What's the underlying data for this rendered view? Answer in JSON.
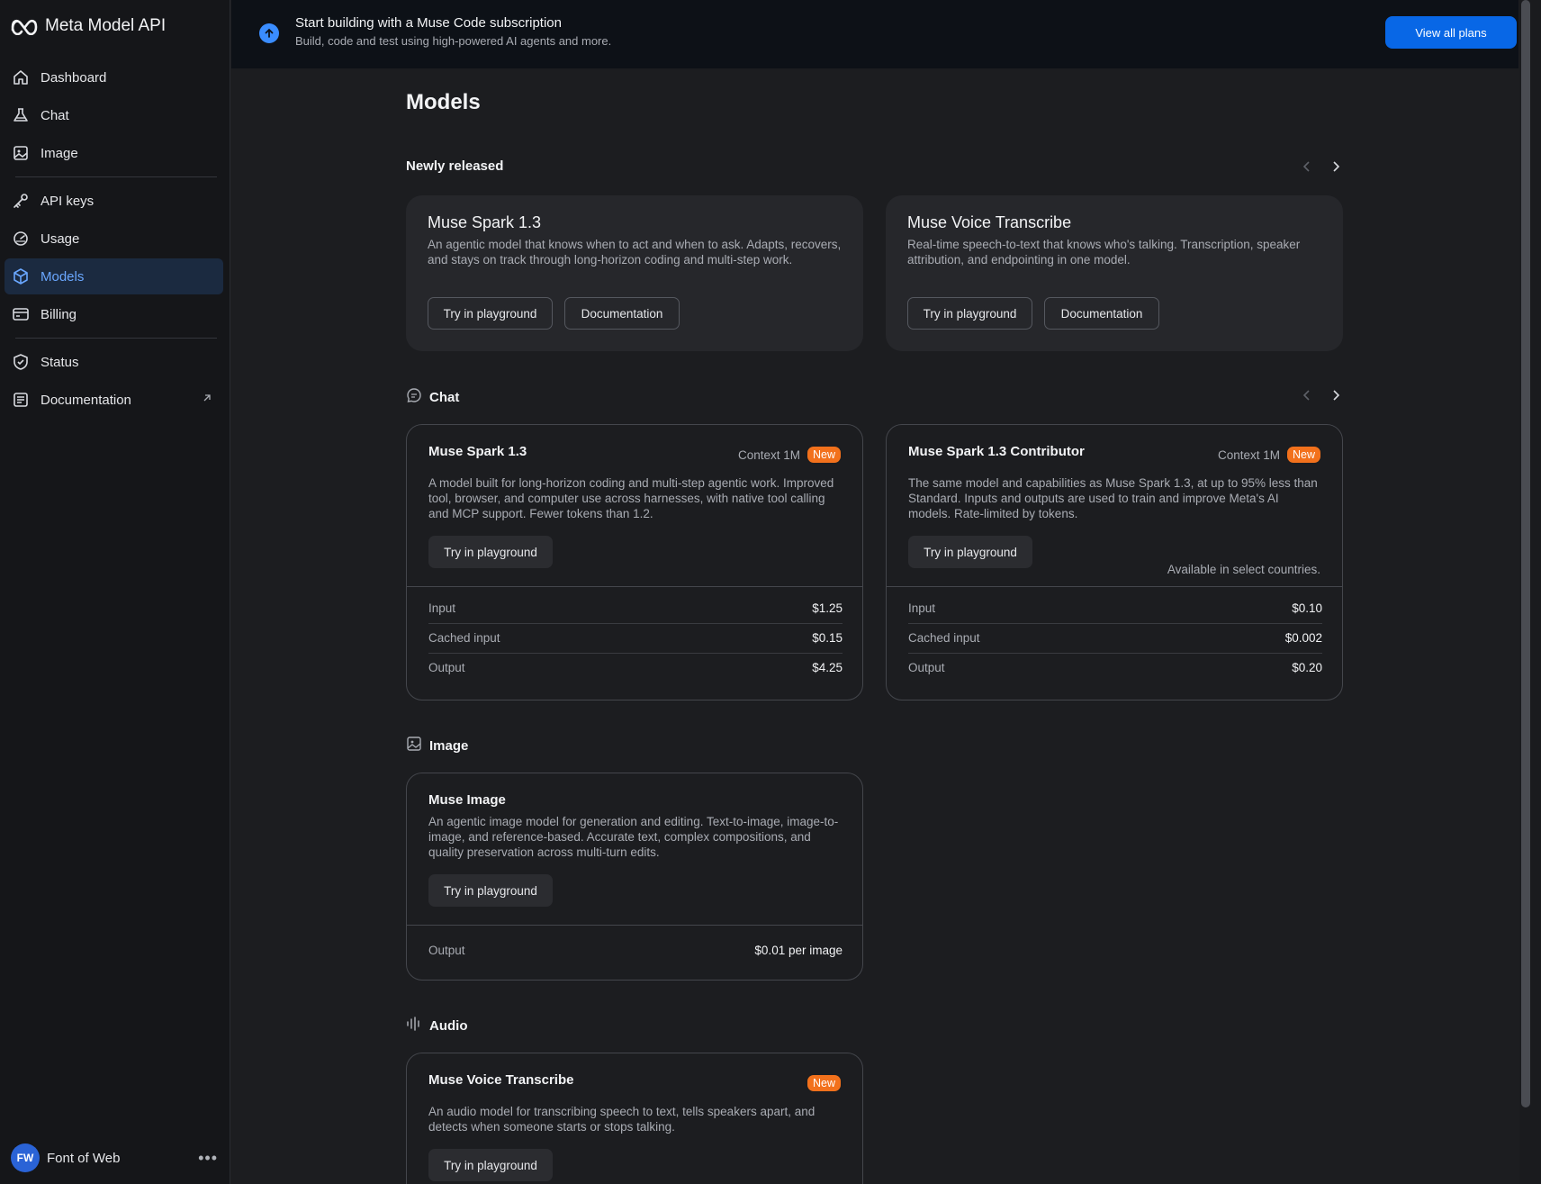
{
  "sidebar": {
    "brand": "Meta Model API",
    "items": [
      {
        "label": "Dashboard",
        "icon": "home-icon"
      },
      {
        "label": "Chat",
        "icon": "flask-icon"
      },
      {
        "label": "Image",
        "icon": "image-icon"
      },
      {
        "label": "API keys",
        "icon": "key-icon"
      },
      {
        "label": "Usage",
        "icon": "gauge-icon"
      },
      {
        "label": "Models",
        "icon": "cube-icon",
        "active": true
      },
      {
        "label": "Billing",
        "icon": "card-icon"
      },
      {
        "label": "Status",
        "icon": "shield-icon"
      },
      {
        "label": "Documentation",
        "icon": "doc-icon",
        "external": true
      }
    ],
    "user": {
      "initials": "FW",
      "name": "Font of Web"
    }
  },
  "banner": {
    "title": "Start building with a Muse Code subscription",
    "subtitle": "Build, code and test using high-powered AI agents and more.",
    "button": "View all plans"
  },
  "page": {
    "title": "Models"
  },
  "newly_released": {
    "title": "Newly released",
    "cards": [
      {
        "title": "Muse Spark 1.3",
        "desc": "An agentic model that knows when to act and when to ask. Adapts, recovers, and stays on track through long-horizon coding and multi-step work.",
        "primary": "Try in playground",
        "secondary": "Documentation"
      },
      {
        "title": "Muse Voice Transcribe",
        "desc": "Real-time speech-to-text that knows who's talking. Transcription, speaker attribution, and endpointing in one model.",
        "primary": "Try in playground",
        "secondary": "Documentation"
      }
    ]
  },
  "chat": {
    "title": "Chat",
    "cards": [
      {
        "title": "Muse Spark 1.3",
        "context": "Context 1M",
        "badge": "New",
        "desc": "A model built for long-horizon coding and multi-step agentic work. Improved tool, browser, and computer use across harnesses, with native tool calling and MCP support. Fewer tokens than 1.2.",
        "button": "Try in playground",
        "note": "",
        "prices": [
          {
            "label": "Input",
            "value": "$1.25"
          },
          {
            "label": "Cached input",
            "value": "$0.15"
          },
          {
            "label": "Output",
            "value": "$4.25"
          }
        ]
      },
      {
        "title": "Muse Spark 1.3 Contributor",
        "context": "Context 1M",
        "badge": "New",
        "desc": "The same model and capabilities as Muse Spark 1.3, at up to 95% less than Standard. Inputs and outputs are used to train and improve Meta's AI models. Rate-limited by tokens.",
        "button": "Try in playground",
        "note": "Available in select countries.",
        "prices": [
          {
            "label": "Input",
            "value": "$0.10"
          },
          {
            "label": "Cached input",
            "value": "$0.002"
          },
          {
            "label": "Output",
            "value": "$0.20"
          }
        ]
      }
    ]
  },
  "image": {
    "title": "Image",
    "card": {
      "title": "Muse Image",
      "desc": "An agentic image model for generation and editing. Text-to-image, image-to-image, and reference-based. Accurate text, complex compositions, and quality preservation across multi-turn edits.",
      "button": "Try in playground",
      "prices": [
        {
          "label": "Output",
          "value": "$0.01 per image"
        }
      ]
    }
  },
  "audio": {
    "title": "Audio",
    "card": {
      "title": "Muse Voice Transcribe",
      "badge": "New",
      "desc": "An audio model for transcribing speech to text, tells speakers apart, and detects when someone starts or stops talking.",
      "button": "Try in playground"
    }
  },
  "colors": {
    "accent": "#0867e6",
    "active_nav": "#6aa7ff",
    "badge": "#f2711c"
  }
}
